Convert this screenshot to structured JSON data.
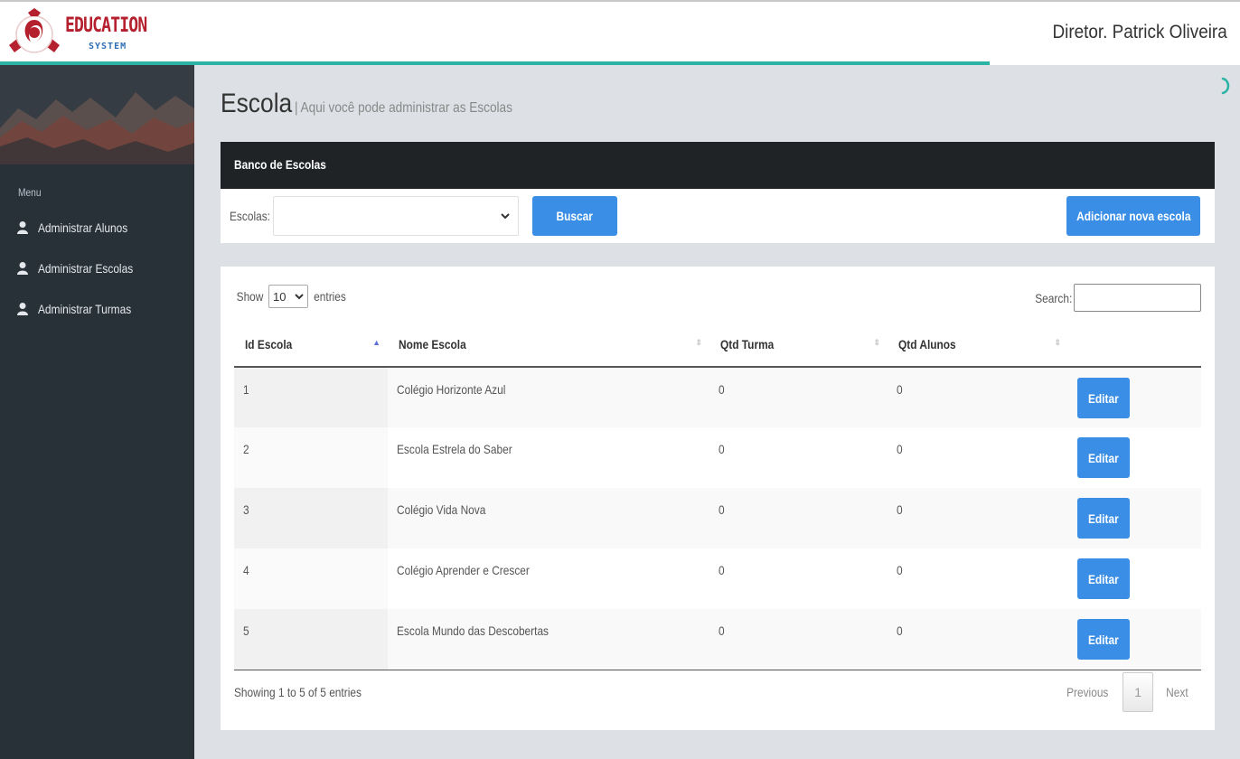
{
  "header": {
    "brand": "EDUCATION",
    "brand_sub": "SYSTEM",
    "user_name": "Diretor. Patrick Oliveira",
    "accent_color": "#2bb3a6",
    "brand_color": "#b5202e"
  },
  "sidebar": {
    "menu_title": "Menu",
    "items": [
      {
        "label": "Administrar Alunos",
        "icon": "user-icon"
      },
      {
        "label": "Administrar Escolas",
        "icon": "user-icon"
      },
      {
        "label": "Administrar Turmas",
        "icon": "user-icon"
      }
    ]
  },
  "page": {
    "title": "Escola",
    "subtitle": "| Aqui você pode administrar as Escolas"
  },
  "panel": {
    "header": "Banco de Escolas",
    "escolas_label": "Escolas:",
    "escolas_value": "",
    "buscar_label": "Buscar",
    "add_label": "Adicionar nova escola"
  },
  "table_controls": {
    "show_label": "Show",
    "length_value": "10",
    "entries_label": "entries",
    "search_label": "Search:",
    "search_value": ""
  },
  "table": {
    "columns": [
      "Id Escola",
      "Nome Escola",
      "Qtd Turma",
      "Qtd Alunos",
      ""
    ],
    "rows": [
      {
        "id": "1",
        "nome": "Colégio Horizonte Azul",
        "turma": "0",
        "alunos": "0",
        "action": "Editar"
      },
      {
        "id": "2",
        "nome": "Escola Estrela do Saber",
        "turma": "0",
        "alunos": "0",
        "action": "Editar"
      },
      {
        "id": "3",
        "nome": "Colégio Vida Nova",
        "turma": "0",
        "alunos": "0",
        "action": "Editar"
      },
      {
        "id": "4",
        "nome": "Colégio Aprender e Crescer",
        "turma": "0",
        "alunos": "0",
        "action": "Editar"
      },
      {
        "id": "5",
        "nome": "Escola Mundo das Descobertas",
        "turma": "0",
        "alunos": "0",
        "action": "Editar"
      }
    ],
    "info": "Showing 1 to 5 of 5 entries"
  },
  "pagination": {
    "previous": "Previous",
    "current": "1",
    "next": "Next"
  }
}
